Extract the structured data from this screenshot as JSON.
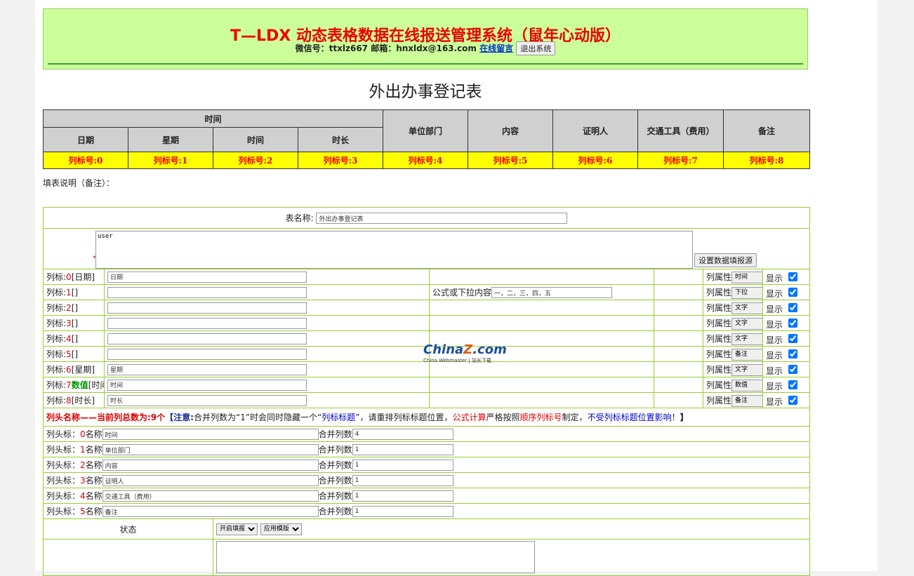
{
  "header": {
    "title": "T—LDX 动态表格数据在线报送管理系统（鼠年心动版）",
    "contact": "微信号：ttxlz667 邮箱：hnxldx@163.com",
    "message_link": "在线留言",
    "logout_label": "退出系统"
  },
  "form_title": "外出办事登记表",
  "preview": {
    "group_label": "时间",
    "sub_columns": [
      "日期",
      "星期",
      "时间",
      "时长"
    ],
    "columns": [
      "单位部门",
      "内容",
      "证明人",
      "交通工具（费用）",
      "备注"
    ],
    "markers": [
      "列标号:0",
      "列标号:1",
      "列标号:2",
      "列标号:3",
      "列标号:4",
      "列标号:5",
      "列标号:6",
      "列标号:7",
      "列标号:8"
    ]
  },
  "fill_note": "填表说明（备注）：",
  "config": {
    "table_name_label": "表名称:",
    "table_name_value": "外出办事登记表",
    "source_value": "user",
    "required_mark": "*",
    "set_source_label": "设置数据填报源",
    "formula_label": "公式或下拉内容",
    "formula_value": "一，二，三，四，五",
    "attr_label": "列属性",
    "show_label": "显示",
    "column_prefix": "列标:",
    "column_rows": [
      {
        "index": "0",
        "extra": "",
        "name": "[日期]",
        "value": "日期",
        "attr": "时间"
      },
      {
        "index": "1",
        "extra": "",
        "name": "[]",
        "value": "",
        "attr": "下拉"
      },
      {
        "index": "2",
        "extra": "",
        "name": "[]",
        "value": "",
        "attr": "文字"
      },
      {
        "index": "3",
        "extra": "",
        "name": "[]",
        "value": "",
        "attr": "文字"
      },
      {
        "index": "4",
        "extra": "",
        "name": "[]",
        "value": "",
        "attr": "文字"
      },
      {
        "index": "5",
        "extra": "",
        "name": "[]",
        "value": "",
        "attr": "备注"
      },
      {
        "index": "6",
        "extra": "",
        "name": "[星期]",
        "value": "星期",
        "attr": "文字"
      },
      {
        "index": "7",
        "extra": "数值",
        "name": "[时间]",
        "value": "时间",
        "attr": "数值"
      },
      {
        "index": "8",
        "extra": "",
        "name": "[时长]",
        "value": "时长",
        "attr": "备注"
      }
    ],
    "notice": {
      "part1": "列头名称——当前列总数为:9个",
      "part2": "【注意:",
      "part3": "合并列数为“1”时会同时隐藏一个“",
      "part4": "列标标题",
      "part5": "”，请重排列标标题位置，",
      "part6": "公式计算",
      "part7": "严格按照",
      "part8": "顺序列标号",
      "part9": "制定，",
      "part10": "不受列标标题位置影响！",
      "part11": "】"
    },
    "head_prefix": "列头标：",
    "head_name_label": "名称",
    "merge_label": "合并列数",
    "head_rows": [
      {
        "index": "0",
        "name": "时间",
        "merge": "4"
      },
      {
        "index": "1",
        "name": "单位部门",
        "merge": "1"
      },
      {
        "index": "2",
        "name": "内容",
        "merge": "1"
      },
      {
        "index": "3",
        "name": "证明人",
        "merge": "1"
      },
      {
        "index": "4",
        "name": "交通工具（费用）",
        "merge": "1"
      },
      {
        "index": "5",
        "name": "备注",
        "merge": "1"
      }
    ],
    "status_label": "状态",
    "status_select": "开启填报",
    "template_select": "应用模版"
  },
  "watermark": {
    "brand": "China",
    "brand_z": "Z",
    "brand_suffix": ".com",
    "tagline": "China Webmaster | 站长下载"
  },
  "colors": {
    "banner_bg": "#ccff99",
    "title_red": "#ee0000",
    "marker_bg": "#ffff00",
    "header_gray": "#d0d0d0",
    "grid_green": "#9acd32"
  }
}
